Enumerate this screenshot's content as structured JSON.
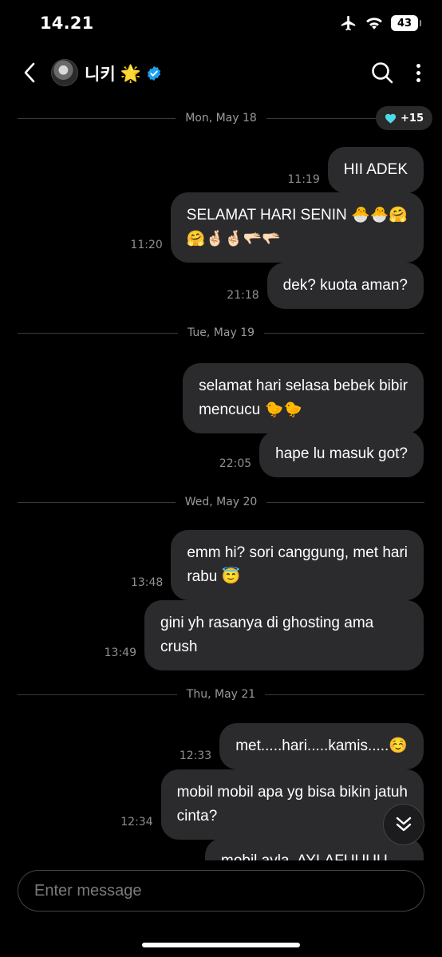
{
  "status_bar": {
    "time": "14.21",
    "battery": "43",
    "icons": [
      "airplane-icon",
      "wifi-icon",
      "battery-icon"
    ]
  },
  "header": {
    "title": "니키",
    "title_emoji": "🌟",
    "icons": [
      "back-chevron-icon",
      "avatar",
      "verified-badge-icon",
      "search-icon",
      "more-vert-icon"
    ]
  },
  "likes_badge": {
    "icon": "heart-icon",
    "label": "+15",
    "color": "#4fd8e8"
  },
  "chat": {
    "dividers": [
      "Mon, May 18",
      "Tue, May 19",
      "Wed, May 20",
      "Thu, May 21"
    ],
    "messages": [
      {
        "time": "11:19",
        "text": "HII ADEK"
      },
      {
        "time": "11:20",
        "text": "SELAMAT HARI SENIN 🐣🐣🤗",
        "text2": "🤗🤞🏻🤞🏻🫳🏻🫳🏻"
      },
      {
        "time": "21:18",
        "text": "dek? kuota aman?"
      },
      {
        "time": "",
        "text": "selamat hari selasa bebek bibir",
        "text2": "mencucu 🐤🐤"
      },
      {
        "time": "22:05",
        "text": "hape lu masuk got?"
      },
      {
        "time": "13:48",
        "text": "emm hi? sori canggung, met hari",
        "text2": "rabu 😇"
      },
      {
        "time": "13:49",
        "text": "gini yh rasanya di ghosting ama",
        "text2": "crush"
      },
      {
        "time": "12:33",
        "text": "met.....hari.....kamis.....☺️"
      },
      {
        "time": "12:34",
        "text": "mobil mobil apa yg bisa bikin jatuh",
        "text2": "cinta?"
      },
      {
        "time": "",
        "text": "mobil ayla. AYLAFUUUU"
      }
    ]
  },
  "composer": {
    "placeholder": "Enter message"
  },
  "colors": {
    "background": "#000000",
    "bubble": "#2b2b2d",
    "verified": "#1da1f2"
  }
}
